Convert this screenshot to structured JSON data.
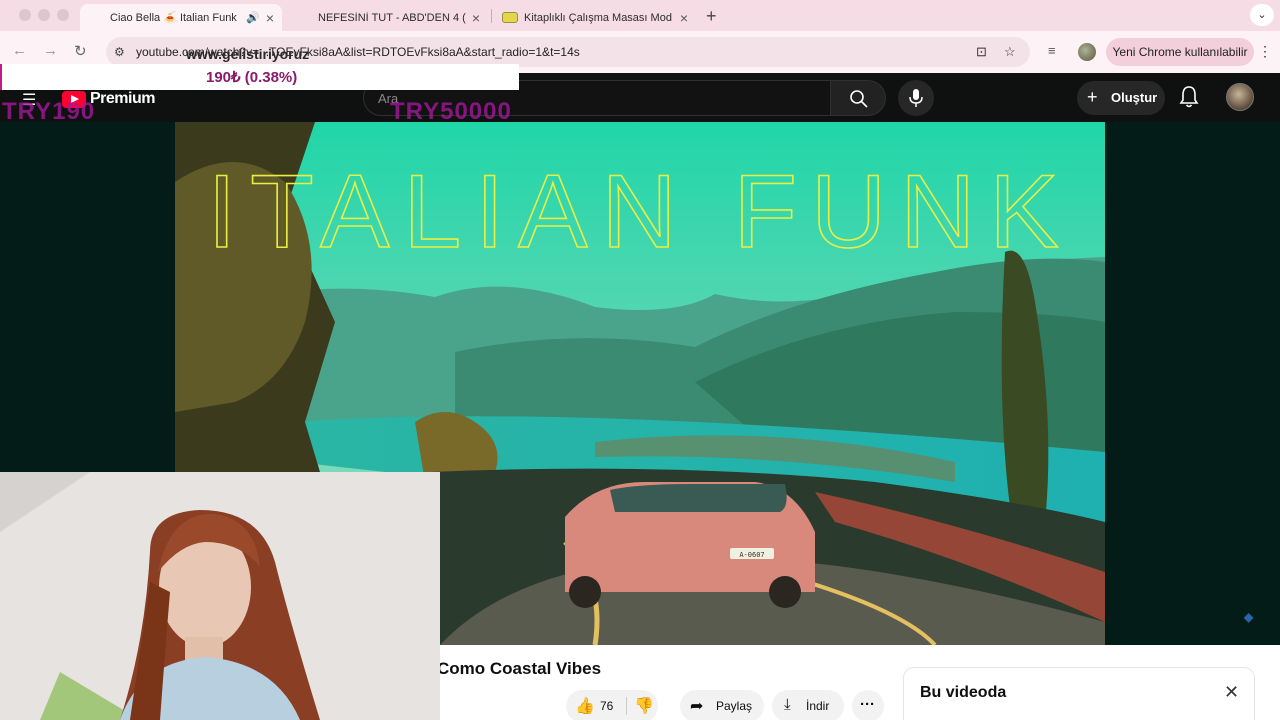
{
  "browser": {
    "tabs": [
      {
        "title": "Ciao Bella 🍝 Italian Funk",
        "active": true,
        "audio": true
      },
      {
        "title": "NEFESİNİ TUT - ABD'DEN 4 (",
        "active": false
      },
      {
        "title": "Kitaplıklı Çalışma Masası Mod",
        "active": false
      }
    ],
    "url": "youtube.com/watch?v=...TOEvFksi8aA&list=RDTOEvFksi8aA&start_radio=1&t=14s",
    "update_chip": "Yeni Chrome kullanılabilir"
  },
  "overlay": {
    "site": "www.gelistiriyoruz",
    "amount": "190₺ (0.38%)",
    "tag_left": "TRY190",
    "tag_right": "TRY50000"
  },
  "youtube": {
    "brand": "Premium",
    "search_placeholder": "Ara",
    "create_label": "Oluştur",
    "video": {
      "title_visible": "Como Coastal Vibes",
      "art_text": "ITALIAN FUNK",
      "plate": "A-0607"
    },
    "actions": {
      "likes": "76",
      "share": "Paylaş",
      "download": "İndir"
    },
    "panel_title": "Bu videoda"
  }
}
